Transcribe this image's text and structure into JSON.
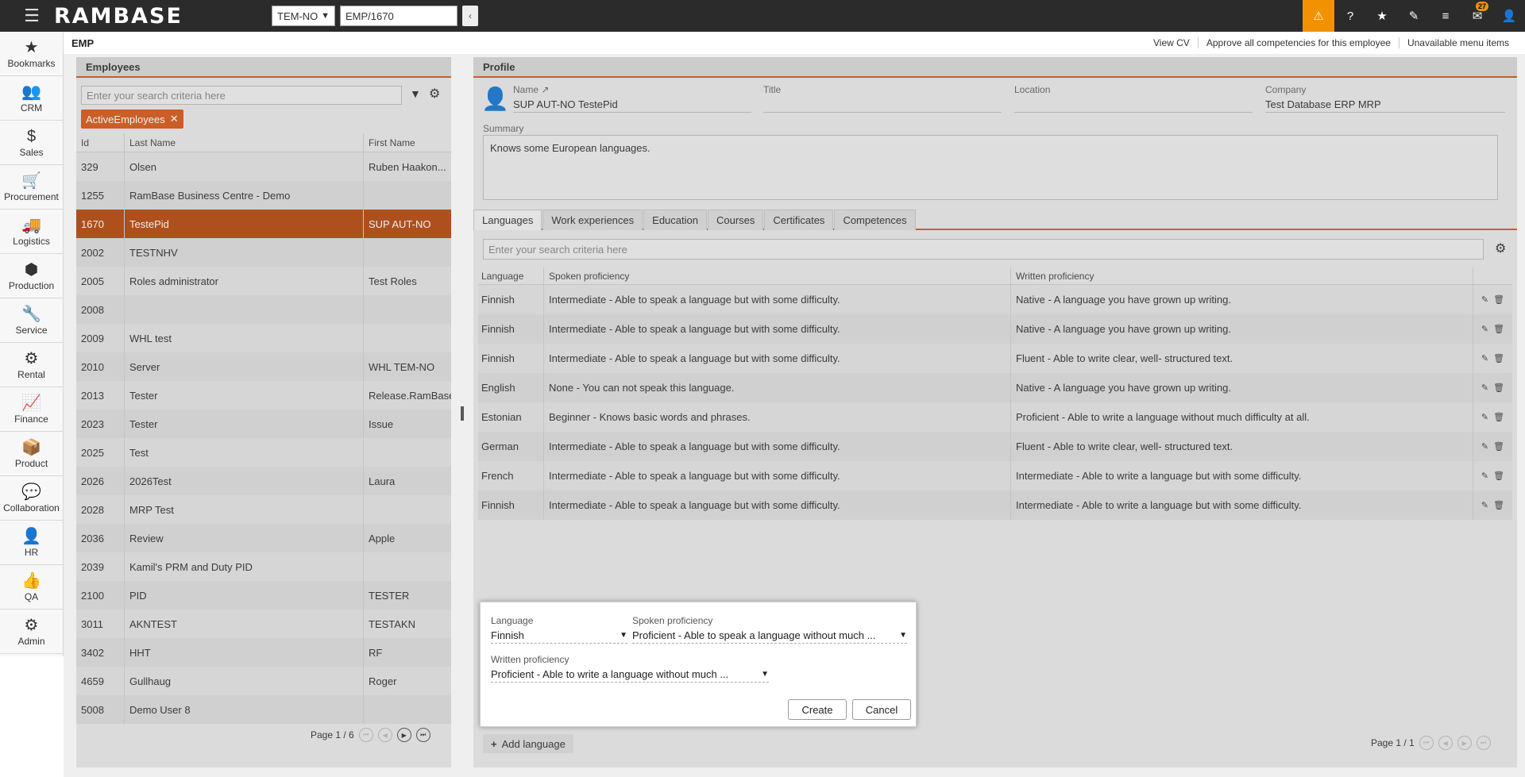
{
  "topbar": {
    "logo": "RAMBASE",
    "company": "TEM-NO",
    "object": "EMP/1670",
    "notifications_count": "27"
  },
  "leftnav": [
    {
      "label": "Bookmarks",
      "icon": "★"
    },
    {
      "label": "CRM",
      "icon": "👥"
    },
    {
      "label": "Sales",
      "icon": "$"
    },
    {
      "label": "Procurement",
      "icon": "🛒"
    },
    {
      "label": "Logistics",
      "icon": "🚚"
    },
    {
      "label": "Production",
      "icon": "⬢"
    },
    {
      "label": "Service",
      "icon": "🔧"
    },
    {
      "label": "Rental",
      "icon": "⚙"
    },
    {
      "label": "Finance",
      "icon": "📈"
    },
    {
      "label": "Product",
      "icon": "📦"
    },
    {
      "label": "Collaboration",
      "icon": "💬"
    },
    {
      "label": "HR",
      "icon": "👤"
    },
    {
      "label": "QA",
      "icon": "👍"
    },
    {
      "label": "Admin",
      "icon": "⚙"
    }
  ],
  "subheader": {
    "title": "EMP",
    "links": [
      "View CV",
      "Approve all competencies for this employee",
      "Unavailable menu items"
    ]
  },
  "employees": {
    "header": "Employees",
    "search_placeholder": "Enter your search criteria here",
    "chip": "ActiveEmployees",
    "columns": [
      "Id",
      "Last Name",
      "First Name"
    ],
    "rows": [
      {
        "id": "329",
        "last": "Olsen",
        "first": "Ruben Haakon..."
      },
      {
        "id": "1255",
        "last": "RamBase Business Centre - Demo",
        "first": ""
      },
      {
        "id": "1670",
        "last": "TestePid",
        "first": "SUP AUT-NO"
      },
      {
        "id": "2002",
        "last": "TESTNHV",
        "first": ""
      },
      {
        "id": "2005",
        "last": "Roles administrator",
        "first": "Test Roles"
      },
      {
        "id": "2008",
        "last": "",
        "first": ""
      },
      {
        "id": "2009",
        "last": "WHL test",
        "first": ""
      },
      {
        "id": "2010",
        "last": "Server",
        "first": "WHL TEM-NO"
      },
      {
        "id": "2013",
        "last": "Tester",
        "first": "Release.RamBase"
      },
      {
        "id": "2023",
        "last": "Tester",
        "first": "Issue"
      },
      {
        "id": "2025",
        "last": "Test",
        "first": ""
      },
      {
        "id": "2026",
        "last": "2026Test",
        "first": "Laura"
      },
      {
        "id": "2028",
        "last": "MRP Test",
        "first": ""
      },
      {
        "id": "2036",
        "last": "Review",
        "first": "Apple"
      },
      {
        "id": "2039",
        "last": "Kamil's PRM and Duty PID",
        "first": ""
      },
      {
        "id": "2100",
        "last": "PID",
        "first": "TESTER"
      },
      {
        "id": "3011",
        "last": "AKNTEST",
        "first": "TESTAKN"
      },
      {
        "id": "3402",
        "last": "HHT",
        "first": "RF"
      },
      {
        "id": "4659",
        "last": "Gullhaug",
        "first": "Roger"
      },
      {
        "id": "5008",
        "last": "Demo User 8",
        "first": ""
      }
    ],
    "pager": "Page 1 / 6"
  },
  "profile": {
    "header": "Profile",
    "name_label": "Name",
    "name_value": "SUP AUT-NO TestePid",
    "title_label": "Title",
    "title_value": "",
    "location_label": "Location",
    "location_value": "",
    "company_label": "Company",
    "company_value": "Test Database ERP MRP",
    "summary_label": "Summary",
    "summary_value": "Knows some European languages.",
    "tabs": [
      "Languages",
      "Work experiences",
      "Education",
      "Courses",
      "Certificates",
      "Competences"
    ],
    "lang_search_placeholder": "Enter your search criteria here",
    "columns": [
      "Language",
      "Spoken proficiency",
      "Written proficiency"
    ],
    "rows": [
      {
        "language": "Finnish",
        "spoken": "Intermediate - Able to speak a language but with some difficulty.",
        "written": "Native - A language you have grown up writing."
      },
      {
        "language": "Finnish",
        "spoken": "Intermediate - Able to speak a language but with some difficulty.",
        "written": "Native - A language you have grown up writing."
      },
      {
        "language": "Finnish",
        "spoken": "Intermediate - Able to speak a language but with some difficulty.",
        "written": "Fluent - Able to write clear, well- structured text."
      },
      {
        "language": "English",
        "spoken": "None - You can not speak this language.",
        "written": "Native - A language you have grown up writing."
      },
      {
        "language": "Estonian",
        "spoken": "Beginner - Knows basic words and phrases.",
        "written": "Proficient - Able to write a language without much difficulty at all."
      },
      {
        "language": "German",
        "spoken": "Intermediate - Able to speak a language but with some difficulty.",
        "written": "Fluent - Able to write clear, well- structured text."
      },
      {
        "language": "French",
        "spoken": "Intermediate - Able to speak a language but with some difficulty.",
        "written": "Intermediate - Able to write a language but with some difficulty."
      },
      {
        "language": "Finnish",
        "spoken": "Intermediate - Able to speak a language but with some difficulty.",
        "written": "Intermediate - Able to write a language but with some difficulty."
      }
    ],
    "add_language": "Add language",
    "pager": "Page 1 / 1"
  },
  "popup": {
    "language_label": "Language",
    "language_value": "Finnish",
    "spoken_label": "Spoken proficiency",
    "spoken_value": "Proficient - Able to speak a language without much ...",
    "written_label": "Written proficiency",
    "written_value": "Proficient - Able to write a language without much ...",
    "create": "Create",
    "cancel": "Cancel"
  }
}
